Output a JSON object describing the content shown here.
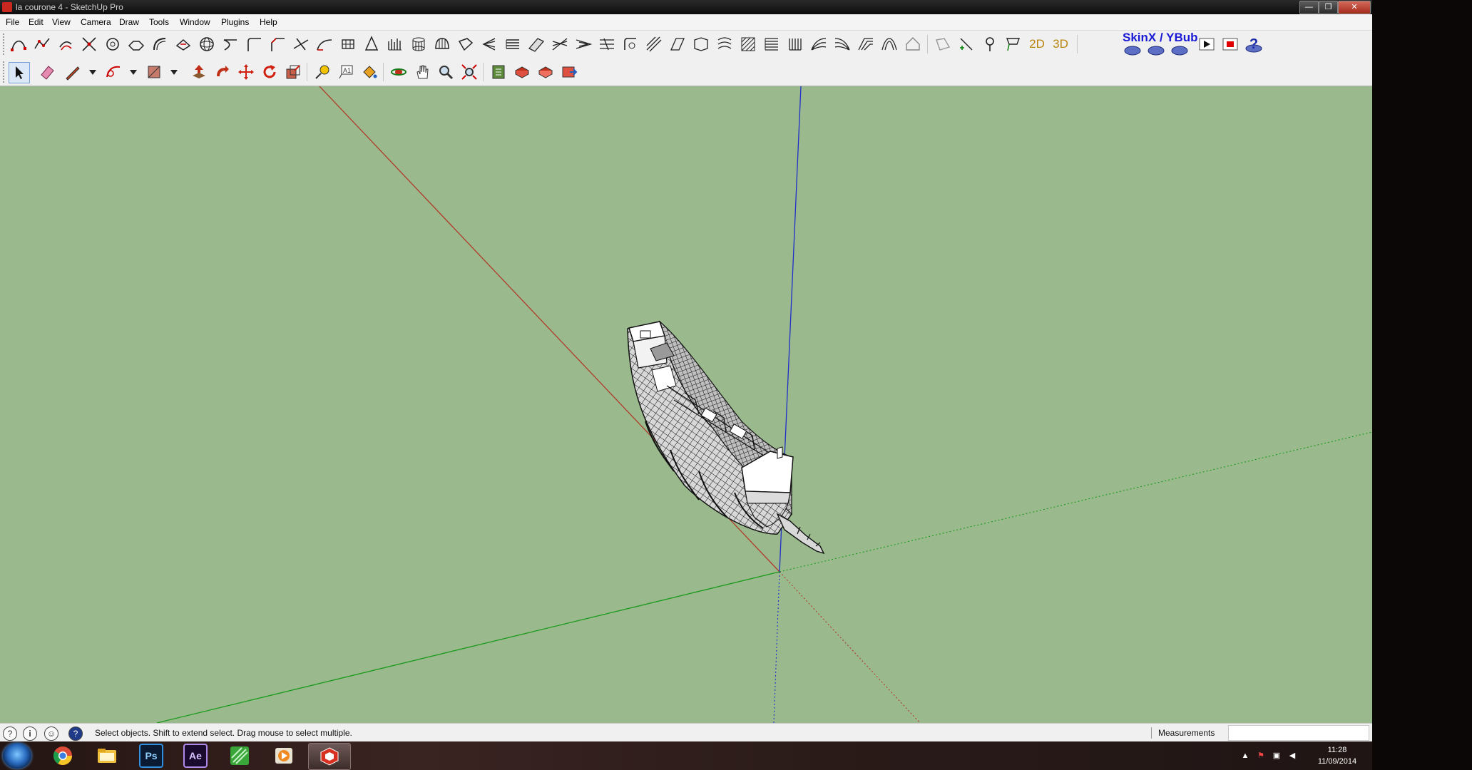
{
  "window": {
    "title": "la courone 4 - SketchUp Pro",
    "controls": {
      "minimize": "—",
      "restore": "❐",
      "close": "✕"
    }
  },
  "menu": [
    "File",
    "Edit",
    "View",
    "Camera",
    "Draw",
    "Tools",
    "Window",
    "Plugins",
    "Help"
  ],
  "toolbar": {
    "label_2d": "2D",
    "label_3d": "3D",
    "plugin_title": "SkinX / YBub"
  },
  "statusbar": {
    "message": "Select objects. Shift to extend select. Drag mouse to select multiple.",
    "measurements_label": "Measurements",
    "measurements_value": ""
  },
  "taskbar": {
    "apps": [
      "chrome",
      "file-explorer",
      "photoshop",
      "after-effects",
      "sketchbook",
      "media-player",
      "sketchup"
    ],
    "ps_label": "Ps",
    "ae_label": "Ae",
    "time": "11:28",
    "date": "11/09/2014"
  },
  "colors": {
    "viewport": "#9aba8e",
    "axis_red": "#c0392b",
    "axis_green": "#1fa21f",
    "axis_blue": "#1f2fc8"
  }
}
